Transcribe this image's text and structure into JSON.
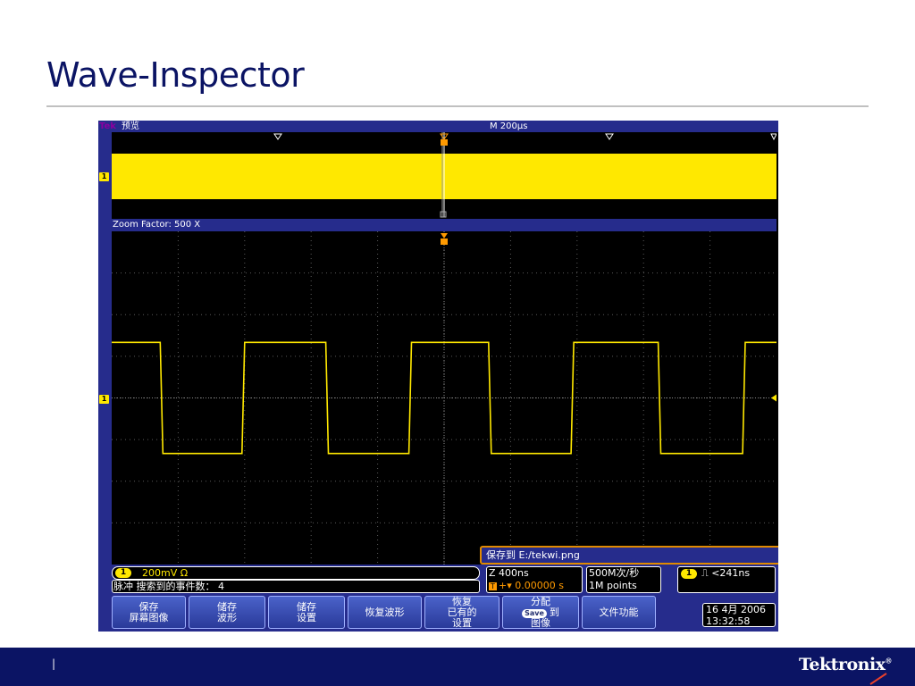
{
  "slide": {
    "title": "Wave-Inspector",
    "page_number": "|"
  },
  "brand": {
    "logo": "Tektronix",
    "registered": "®"
  },
  "scope": {
    "brand_tag": "Tek",
    "mode": "预览",
    "timebase": "M 200µs",
    "zoom_factor": "Zoom Factor: 500 X",
    "channel_marker": "1",
    "save_path": "保存到 E:/tekwi.png",
    "channel": {
      "badge": "1",
      "scale": "200mV Ω"
    },
    "pulse_search": "脉冲 搜索到的事件数： 4",
    "zoom": {
      "timebase": "Z 400ns",
      "trigger_badge": "T",
      "position": "+▾ 0.00000 s"
    },
    "sampling": {
      "rate": "500M次/秒",
      "points": "1M points"
    },
    "trigger": {
      "badge": "1",
      "condition": "⎍ <241ns"
    },
    "buttons": [
      {
        "label": "保存\n屏幕图像"
      },
      {
        "label": "储存\n波形"
      },
      {
        "label": "储存\n设置"
      },
      {
        "label": "恢复波形"
      },
      {
        "label": "恢复\n已有的\n设置"
      },
      {
        "label_top": "分配",
        "save_pill": "Save",
        "label_mid": "到",
        "label_bottom": "图像"
      },
      {
        "label": "文件功能"
      }
    ],
    "datetime": {
      "date": "16 4月 2006",
      "time": "13:32:58"
    },
    "colors": {
      "waveform": "#ffe800",
      "ui_blue": "#262c8c",
      "accent_orange": "#e08a00"
    }
  },
  "chart_data": {
    "type": "line",
    "title": "",
    "xlabel": "",
    "ylabel": "",
    "grid": true,
    "series": [
      {
        "name": "1",
        "x": [
          0,
          0.073,
          0.077,
          0.196,
          0.2,
          0.322,
          0.326,
          0.447,
          0.451,
          0.567,
          0.571,
          0.691,
          0.695,
          0.822,
          0.826,
          0.949,
          0.953,
          1.0
        ],
        "y": [
          1,
          1,
          0,
          0,
          1,
          1,
          0,
          0,
          1,
          1,
          0,
          0,
          1,
          1,
          0,
          0,
          1,
          1
        ]
      }
    ],
    "xlim": [
      0,
      1
    ],
    "ylim": [
      -1,
      2
    ]
  }
}
